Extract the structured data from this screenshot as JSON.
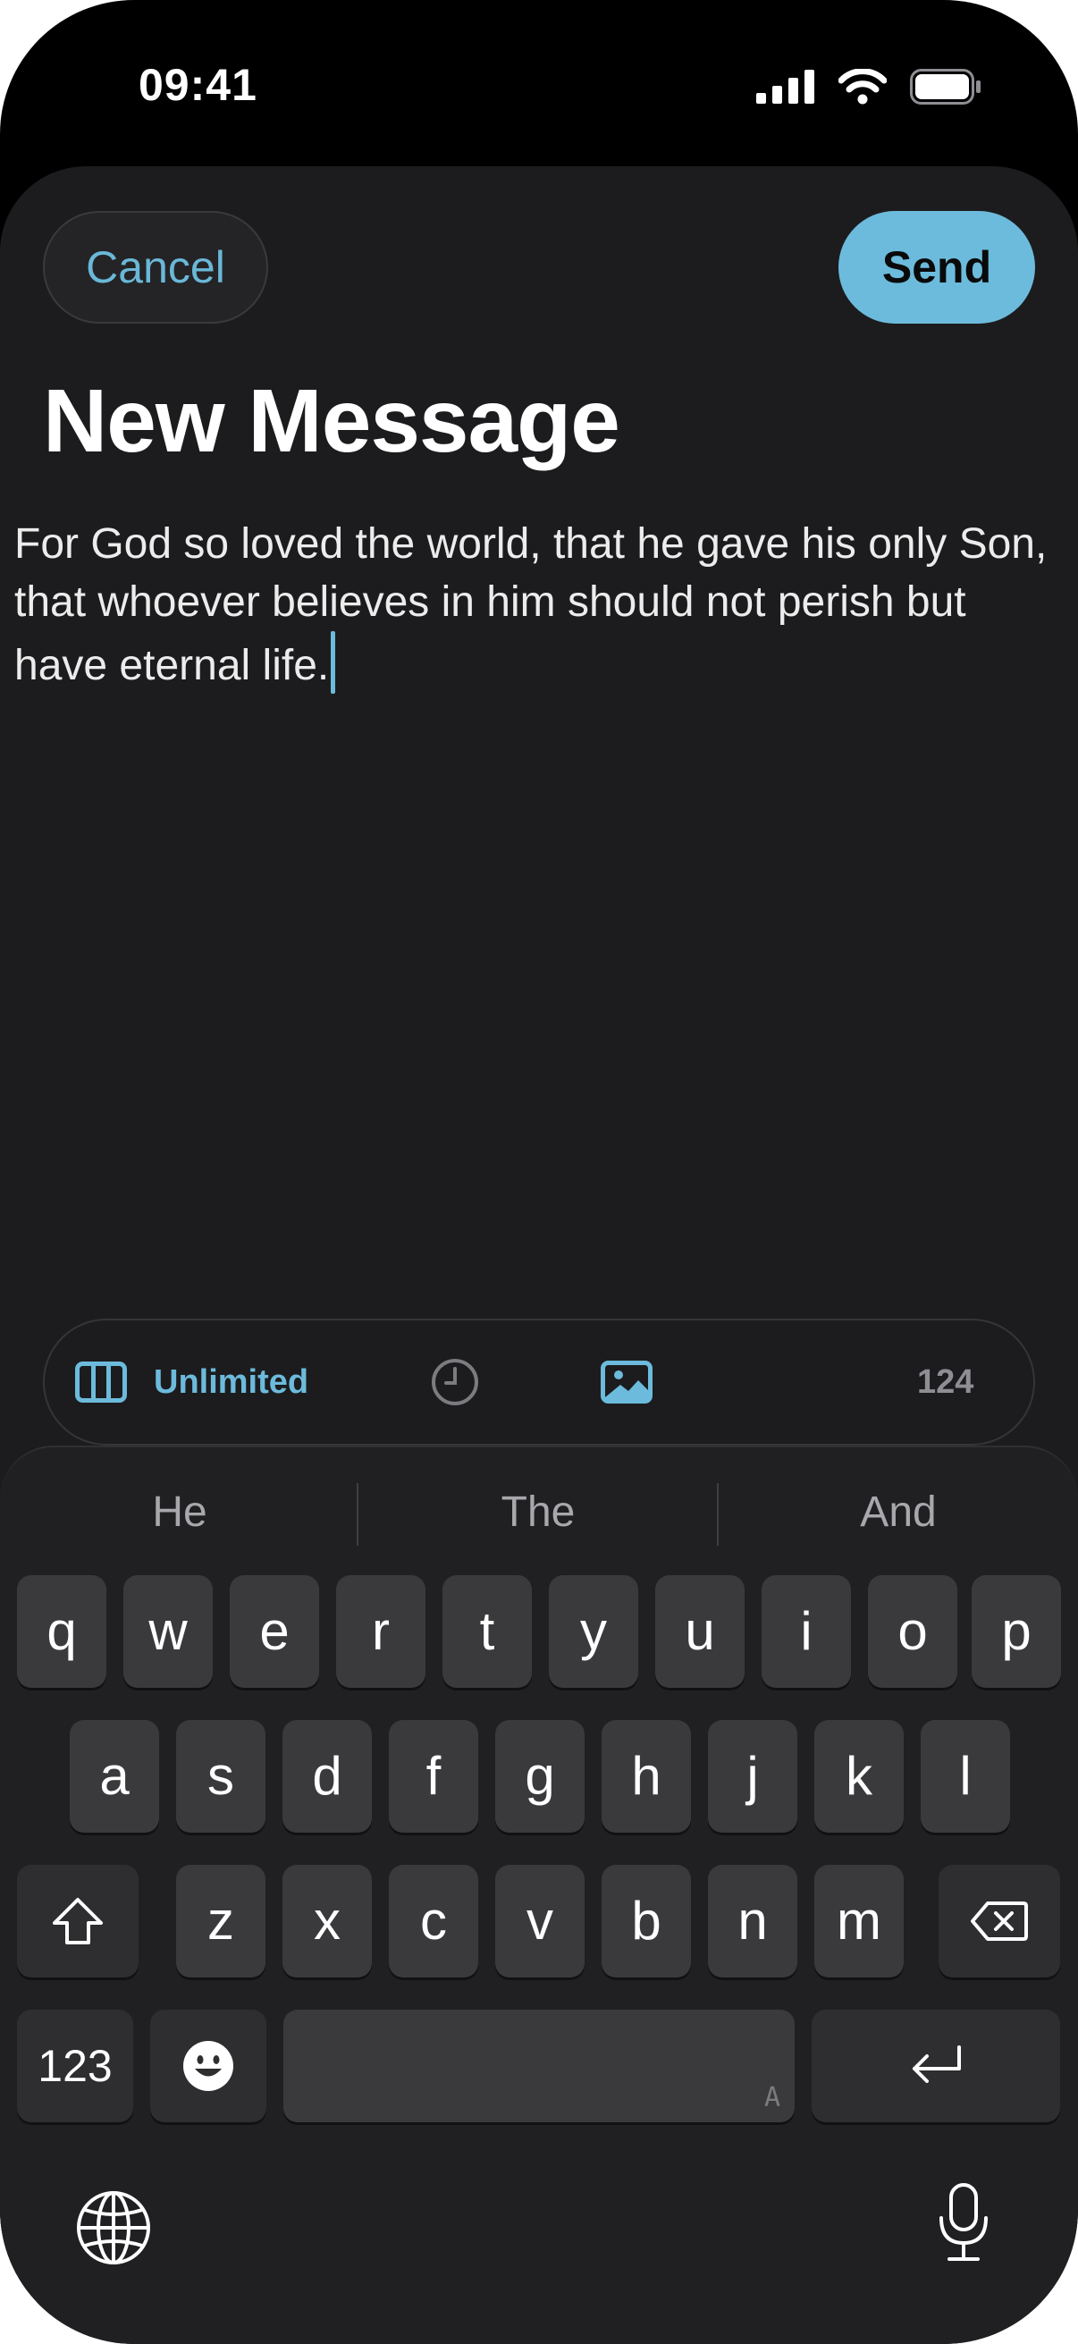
{
  "status_bar": {
    "time": "09:41"
  },
  "compose": {
    "cancel_label": "Cancel",
    "send_label": "Send",
    "title": "New Message",
    "body_text": "For God so loved the world, that he gave his only Son, that whoever believes in him should not perish but have eternal life."
  },
  "toolbar": {
    "format_icon": "columns-icon",
    "unlimited_label": "Unlimited",
    "schedule_icon": "clock-icon",
    "image_icon": "image-icon",
    "char_count": "124"
  },
  "keyboard": {
    "suggestions": [
      "He",
      "The",
      "And"
    ],
    "row1": [
      "q",
      "w",
      "e",
      "r",
      "t",
      "y",
      "u",
      "i",
      "o",
      "p"
    ],
    "row2": [
      "a",
      "s",
      "d",
      "f",
      "g",
      "h",
      "j",
      "k",
      "l"
    ],
    "row3": [
      "z",
      "x",
      "c",
      "v",
      "b",
      "n",
      "m"
    ],
    "numbers_label": "123",
    "space_marker": "A",
    "icons": [
      "shift-icon",
      "backspace-icon",
      "emoji-icon",
      "return-icon",
      "globe-icon",
      "microphone-icon"
    ]
  },
  "colors": {
    "accent": "#6cbbdc",
    "sheet_background": "#1c1c1e",
    "key_background": "#3a3a3c",
    "keyboard_background": "#202022"
  }
}
